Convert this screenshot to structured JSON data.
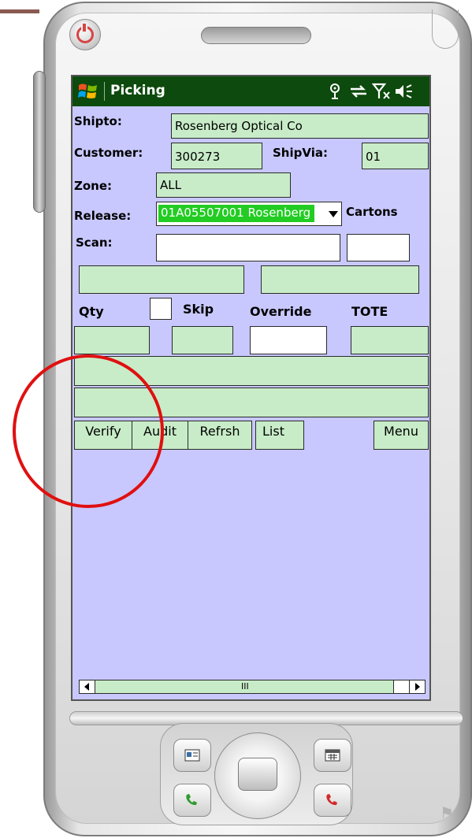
{
  "app": {
    "title": "Picking"
  },
  "status_icons": [
    "connectivity-icon",
    "sync-icon",
    "no-signal-icon",
    "volume-icon"
  ],
  "form": {
    "shipto": {
      "label": "Shipto:",
      "value": "Rosenberg Optical Co"
    },
    "customer": {
      "label": "Customer:",
      "value": "300273"
    },
    "shipvia": {
      "label": "ShipVia:",
      "value": "01"
    },
    "zone": {
      "label": "Zone:",
      "value": "ALL"
    },
    "release": {
      "label": "Release:",
      "value": "01A05507001 Rosenberg"
    },
    "cartons": {
      "label": "Cartons",
      "value": ""
    },
    "scan": {
      "label": "Scan:",
      "value": ""
    },
    "qty": {
      "label": "Qty"
    },
    "skip": {
      "label": "Skip",
      "checked": false
    },
    "override": {
      "label": "Override"
    },
    "tote": {
      "label": "TOTE"
    }
  },
  "buttons": {
    "verify": "Verify",
    "audit": "Audit",
    "refresh": "Refrsh",
    "list": "List",
    "menu": "Menu"
  },
  "scrollbar": {
    "grip": "III"
  },
  "colors": {
    "title_bar": "#0d4a0d",
    "screen_bg": "#c8c8ff",
    "field_bg": "#c8ecc8",
    "selection": "#22cc22",
    "annotation": "#e01010"
  }
}
